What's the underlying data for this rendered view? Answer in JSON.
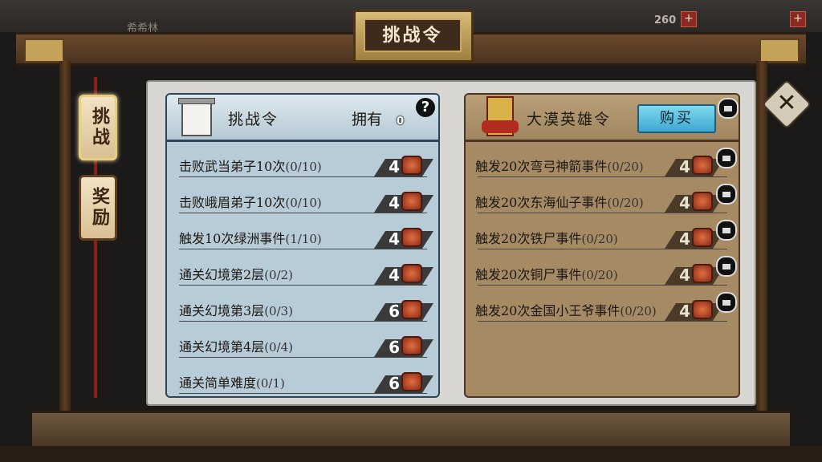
{
  "top_bar": {
    "player_name": "希希林",
    "coins": "260"
  },
  "title": "挑战令",
  "side_tabs": [
    {
      "label": "挑战"
    },
    {
      "label": "奖励"
    }
  ],
  "left_panel": {
    "title": "挑战令",
    "owned_label": "拥有",
    "owned_count": "0",
    "help_label": "?",
    "tasks": [
      {
        "text": "击败武当弟子10次",
        "progress": "(0/10)",
        "reward": "4"
      },
      {
        "text": "击败峨眉弟子10次",
        "progress": "(0/10)",
        "reward": "4"
      },
      {
        "text": "触发10次绿洲事件",
        "progress": "(1/10)",
        "reward": "4"
      },
      {
        "text": "通关幻境第2层",
        "progress": "(0/2)",
        "reward": "4"
      },
      {
        "text": "通关幻境第3层",
        "progress": "(0/3)",
        "reward": "6"
      },
      {
        "text": "通关幻境第4层",
        "progress": "(0/4)",
        "reward": "6"
      },
      {
        "text": "通关简单难度",
        "progress": "(0/1)",
        "reward": "6"
      }
    ]
  },
  "right_panel": {
    "title": "大漠英雄令",
    "buy_label": "购买",
    "tasks": [
      {
        "text": "触发20次弯弓神箭事件",
        "progress": "(0/20)",
        "reward": "4"
      },
      {
        "text": "触发20次东海仙子事件",
        "progress": "(0/20)",
        "reward": "4"
      },
      {
        "text": "触发20次铁尸事件",
        "progress": "(0/20)",
        "reward": "4"
      },
      {
        "text": "触发20次铜尸事件",
        "progress": "(0/20)",
        "reward": "4"
      },
      {
        "text": "触发20次金国小王爷事件",
        "progress": "(0/20)",
        "reward": "4"
      }
    ]
  },
  "close_label": "✕",
  "colors": {
    "left_panel_bg": "#b8ccd8",
    "right_panel_bg": "#a58a64",
    "buy_button": "#5ac4e2"
  }
}
